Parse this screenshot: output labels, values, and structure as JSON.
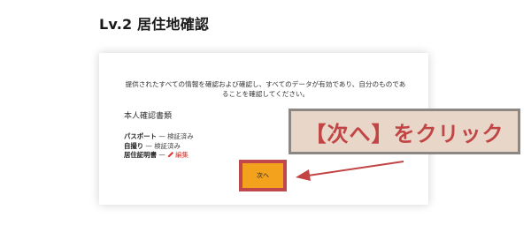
{
  "page": {
    "title": "Lv.2 居住地確認"
  },
  "card": {
    "description": "提供されたすべての情報を確認および確認し、すべてのデータが有効であり、自分のものであることを確認してください。",
    "section_title": "本人確認書類",
    "documents": [
      {
        "name": "パスポート",
        "separator": " — ",
        "status": "検証済み"
      },
      {
        "name": "自撮り",
        "separator": " — ",
        "status": "検証済み"
      },
      {
        "name": "居住証明書",
        "separator": " — ",
        "action": "編集"
      }
    ],
    "next_button": "次へ"
  },
  "annotation": {
    "text": "【次へ】をクリック"
  },
  "colors": {
    "button": "#f2a21d",
    "highlight": "#c0474a",
    "annotation_bg": "#e8d6c9",
    "annotation_text": "#c24545",
    "edit_link": "#e0322b"
  },
  "icons": {
    "edit": "pencil-icon"
  }
}
